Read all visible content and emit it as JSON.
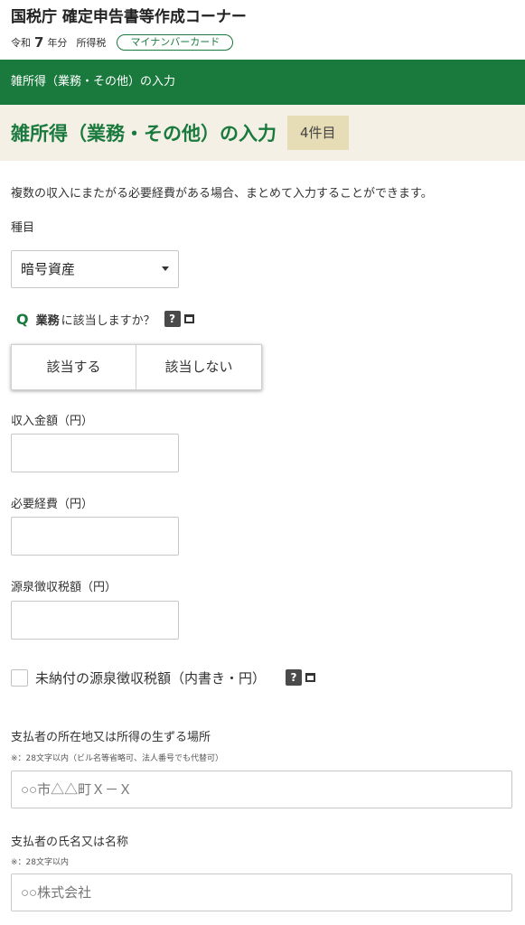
{
  "header": {
    "site_title": "国税庁 確定申告書等作成コーナー",
    "era_prefix": "令和",
    "era_year": "7",
    "era_suffix": "年分",
    "tax_type": "所得税",
    "mynumber_label": "マイナンバーカード"
  },
  "breadcrumb_bar": {
    "label": "雑所得（業務・その他）の入力"
  },
  "title_band": {
    "title": "雑所得（業務・その他）の入力",
    "count": "4件目"
  },
  "form": {
    "description": "複数の収入にまたがる必要経費がある場合、まとめて入力することができます。",
    "category_label": "種目",
    "category_value": "暗号資産",
    "question": {
      "q": "Q",
      "bold": "業務",
      "rest": "に該当しますか？",
      "help": "?"
    },
    "answer_yes": "該当する",
    "answer_no": "該当しない",
    "income_label": "収入金額（円）",
    "income_value": "",
    "expenses_label": "必要経費（円）",
    "expenses_value": "",
    "withholding_label": "源泉徴収税額（円）",
    "withholding_value": "",
    "unpaid_label": "未納付の源泉徴収税額（内書き・円）",
    "unpaid_help": "?",
    "payer_address_label": "支払者の所在地又は所得の生ずる場所",
    "payer_address_note": "※：28文字以内（ビル名等省略可、法人番号でも代替可）",
    "payer_address_placeholder": "○○市△△町Ｘ－Ｘ",
    "payer_name_label": "支払者の氏名又は名称",
    "payer_name_note": "※：28文字以内",
    "payer_name_placeholder": "○○株式会社"
  },
  "colors": {
    "brand_green": "#1a7a3e",
    "title_band": "#f4f0e6",
    "badge": "#e6dcb6"
  }
}
